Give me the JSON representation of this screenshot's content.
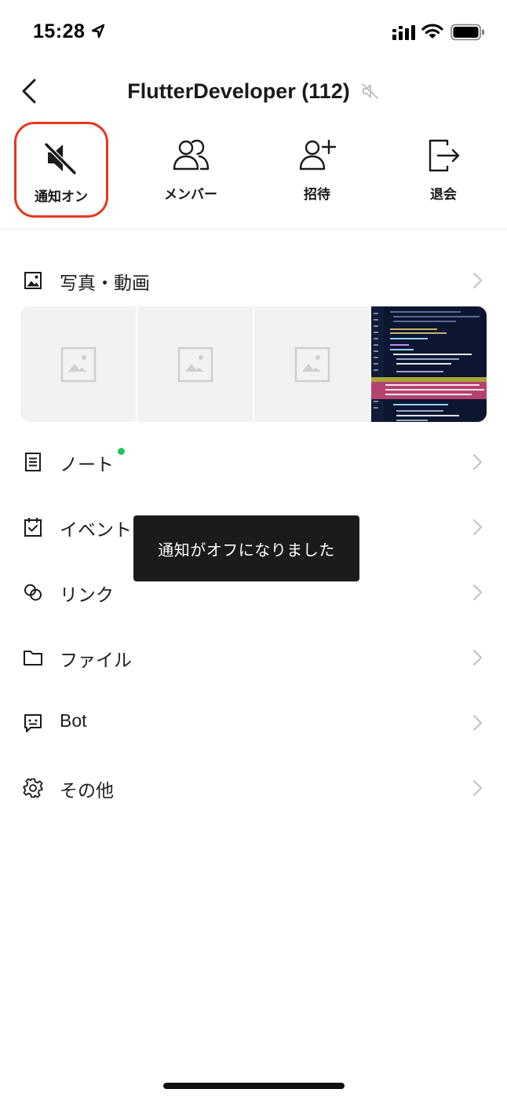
{
  "status_bar": {
    "time": "15:28",
    "icons": [
      "location-arrow-icon",
      "cellular-signal-icon",
      "wifi-icon",
      "battery-icon"
    ]
  },
  "header": {
    "title": "FlutterDeveloper (112)",
    "back_icon": "chevron-left-icon",
    "muted_icon": "speaker-muted-icon"
  },
  "actions": [
    {
      "label": "通知オン",
      "icon": "speaker-muted-icon",
      "highlighted": true
    },
    {
      "label": "メンバー",
      "icon": "members-icon"
    },
    {
      "label": "招待",
      "icon": "add-person-icon"
    },
    {
      "label": "退会",
      "icon": "exit-icon"
    }
  ],
  "menu": {
    "photos": {
      "label": "写真・動画",
      "icon": "image-icon"
    },
    "note": {
      "label": "ノート",
      "icon": "note-icon",
      "has_new_dot": true,
      "dot_color": "#22c45a"
    },
    "event": {
      "label": "イベント",
      "icon": "calendar-check-icon"
    },
    "link": {
      "label": "リンク",
      "icon": "link-icon"
    },
    "file": {
      "label": "ファイル",
      "icon": "folder-icon"
    },
    "bot": {
      "label": "Bot",
      "icon": "bot-face-icon"
    },
    "other": {
      "label": "その他",
      "icon": "gear-icon"
    }
  },
  "photo_strip": {
    "thumbnails": [
      "image-placeholder-icon",
      "image-placeholder-icon",
      "image-placeholder-icon",
      "code-screenshot"
    ]
  },
  "toast": {
    "message": "通知がオフになりました"
  },
  "colors": {
    "highlight_border": "#e5371f",
    "toast_background": "#1b1b1b",
    "new_dot": "#22c45a"
  }
}
